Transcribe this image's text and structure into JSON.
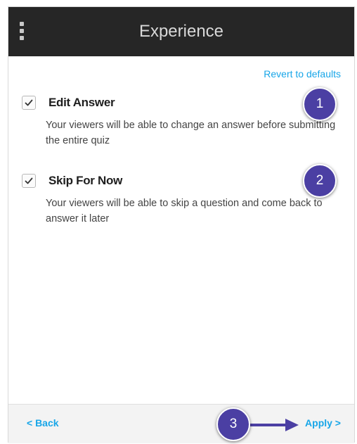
{
  "header": {
    "title": "Experience",
    "menu_icon": "vertical-ellipsis-icon"
  },
  "revert_label": "Revert to defaults",
  "options": [
    {
      "label": "Edit Answer",
      "checked": true,
      "description": "Your viewers will be able to change an answer before submitting the entire quiz",
      "badge": "1"
    },
    {
      "label": "Skip For Now",
      "checked": true,
      "description": "Your viewers will be able to skip a question and come back to answer it later",
      "badge": "2"
    }
  ],
  "footer": {
    "back_label": "< Back",
    "apply_label": "Apply >",
    "badge": "3"
  },
  "colors": {
    "header_bg": "#262626",
    "link": "#18a6e8",
    "badge": "#4b3fa3"
  }
}
